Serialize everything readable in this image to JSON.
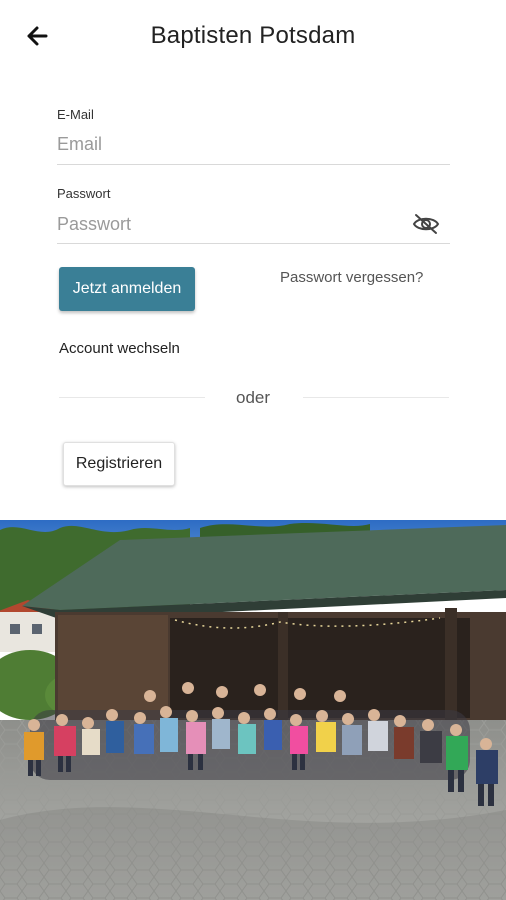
{
  "header": {
    "title": "Baptisten Potsdam",
    "back_icon": "arrow-left-icon"
  },
  "form": {
    "email": {
      "label": "E-Mail",
      "placeholder": "Email",
      "value": ""
    },
    "password": {
      "label": "Passwort",
      "placeholder": "Passwort",
      "value": "",
      "visibility_icon": "eye-off-icon"
    }
  },
  "actions": {
    "login_label": "Jetzt anmelden",
    "forgot_label": "Passwort vergessen?",
    "switch_account_label": "Account wechseln",
    "divider_label": "oder",
    "register_label": "Registrieren"
  },
  "colors": {
    "primary": "#3a7f96",
    "background": "#ffffff",
    "text": "#222222",
    "muted": "#9a9a9a"
  },
  "hero_image": {
    "subject": "group-photo-community-barn"
  }
}
